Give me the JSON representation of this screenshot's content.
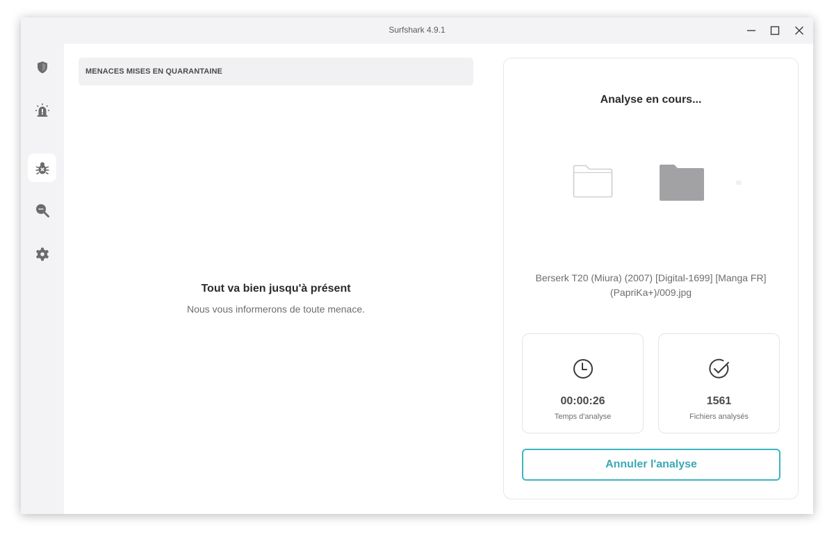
{
  "window": {
    "title": "Surfshark 4.9.1"
  },
  "sidebar": {
    "items": [
      {
        "id": "vpn",
        "icon": "shield-icon",
        "active": false
      },
      {
        "id": "alert",
        "icon": "alarm-icon",
        "active": false
      },
      {
        "id": "antivirus",
        "icon": "bug-icon",
        "active": true
      },
      {
        "id": "search",
        "icon": "search-icon",
        "active": false
      },
      {
        "id": "settings",
        "icon": "gear-icon",
        "active": false
      }
    ]
  },
  "quarantine": {
    "header": "MENACES MISES EN QUARANTAINE",
    "empty_title": "Tout va bien jusqu'à présent",
    "empty_subtitle": "Nous vous informerons de toute menace."
  },
  "scan": {
    "title": "Analyse en cours...",
    "current_file": "Berserk T20 (Miura) (2007) [Digital-1699] [Manga FR] (PapriKa+)/009.jpg",
    "time": {
      "value": "00:00:26",
      "label": "Temps d'analyse",
      "icon": "clock-icon"
    },
    "files": {
      "value": "1561",
      "label": "Fichiers analysés",
      "icon": "check-circle-icon"
    },
    "cancel_label": "Annuler l'analyse"
  },
  "colors": {
    "accent": "#3bb5c1",
    "icon_gray": "#6b6b6b",
    "sidebar_bg": "#f3f3f5"
  }
}
